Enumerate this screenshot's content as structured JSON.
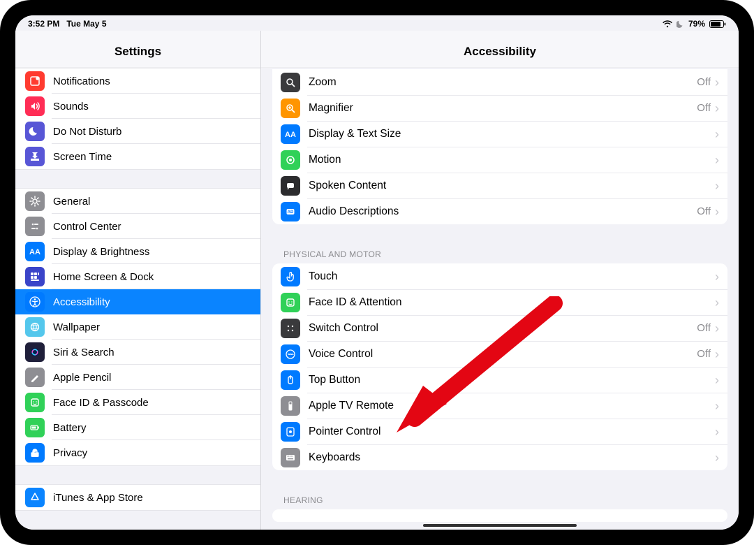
{
  "status": {
    "time": "3:52 PM",
    "date": "Tue May 5",
    "battery_percent": "79%"
  },
  "sidebar": {
    "title": "Settings",
    "group1": [
      {
        "label": "Notifications",
        "icon_bg": "#ff3b30",
        "glyph": "notifications"
      },
      {
        "label": "Sounds",
        "icon_bg": "#ff2d55",
        "glyph": "sounds"
      },
      {
        "label": "Do Not Disturb",
        "icon_bg": "#5856d6",
        "glyph": "dnd"
      },
      {
        "label": "Screen Time",
        "icon_bg": "#5856d6",
        "glyph": "screentime"
      }
    ],
    "group2": [
      {
        "label": "General",
        "icon_bg": "#8e8e93",
        "glyph": "general"
      },
      {
        "label": "Control Center",
        "icon_bg": "#8e8e93",
        "glyph": "controlcenter"
      },
      {
        "label": "Display & Brightness",
        "icon_bg": "#007aff",
        "glyph": "display"
      },
      {
        "label": "Home Screen & Dock",
        "icon_bg": "#3a44c9",
        "glyph": "homescreen"
      },
      {
        "label": "Accessibility",
        "icon_bg": "#007aff",
        "glyph": "accessibility",
        "selected": true
      },
      {
        "label": "Wallpaper",
        "icon_bg": "#54c7ec",
        "glyph": "wallpaper"
      },
      {
        "label": "Siri & Search",
        "icon_bg": "#1f1f3a",
        "glyph": "siri"
      },
      {
        "label": "Apple Pencil",
        "icon_bg": "#8e8e93",
        "glyph": "pencil"
      },
      {
        "label": "Face ID & Passcode",
        "icon_bg": "#30d158",
        "glyph": "faceid"
      },
      {
        "label": "Battery",
        "icon_bg": "#30d158",
        "glyph": "battery"
      },
      {
        "label": "Privacy",
        "icon_bg": "#007aff",
        "glyph": "privacy"
      }
    ],
    "group3": [
      {
        "label": "iTunes & App Store",
        "icon_bg": "#0a84ff",
        "glyph": "appstore"
      }
    ]
  },
  "detail": {
    "title": "Accessibility",
    "vision": [
      {
        "label": "Zoom",
        "icon_bg": "#3a3a3c",
        "glyph": "zoom",
        "value": "Off"
      },
      {
        "label": "Magnifier",
        "icon_bg": "#ff9500",
        "glyph": "magnifier",
        "value": "Off"
      },
      {
        "label": "Display & Text Size",
        "icon_bg": "#007aff",
        "glyph": "textsize",
        "value": ""
      },
      {
        "label": "Motion",
        "icon_bg": "#30d158",
        "glyph": "motion",
        "value": ""
      },
      {
        "label": "Spoken Content",
        "icon_bg": "#2c2c2e",
        "glyph": "spoken",
        "value": ""
      },
      {
        "label": "Audio Descriptions",
        "icon_bg": "#007aff",
        "glyph": "audiodesc",
        "value": "Off"
      }
    ],
    "physical_header": "Physical and Motor",
    "physical": [
      {
        "label": "Touch",
        "icon_bg": "#007aff",
        "glyph": "touch",
        "value": ""
      },
      {
        "label": "Face ID & Attention",
        "icon_bg": "#30d158",
        "glyph": "faceid2",
        "value": ""
      },
      {
        "label": "Switch Control",
        "icon_bg": "#3a3a3c",
        "glyph": "switch",
        "value": "Off"
      },
      {
        "label": "Voice Control",
        "icon_bg": "#007aff",
        "glyph": "voice",
        "value": "Off"
      },
      {
        "label": "Top Button",
        "icon_bg": "#007aff",
        "glyph": "topbutton",
        "value": ""
      },
      {
        "label": "Apple TV Remote",
        "icon_bg": "#8e8e93",
        "glyph": "tvremote",
        "value": ""
      },
      {
        "label": "Pointer Control",
        "icon_bg": "#007aff",
        "glyph": "pointer",
        "value": ""
      },
      {
        "label": "Keyboards",
        "icon_bg": "#8e8e93",
        "glyph": "keyboard",
        "value": ""
      }
    ],
    "hearing_header": "Hearing"
  },
  "colors": {
    "accent": "#0a84ff",
    "arrow": "#e30613"
  }
}
